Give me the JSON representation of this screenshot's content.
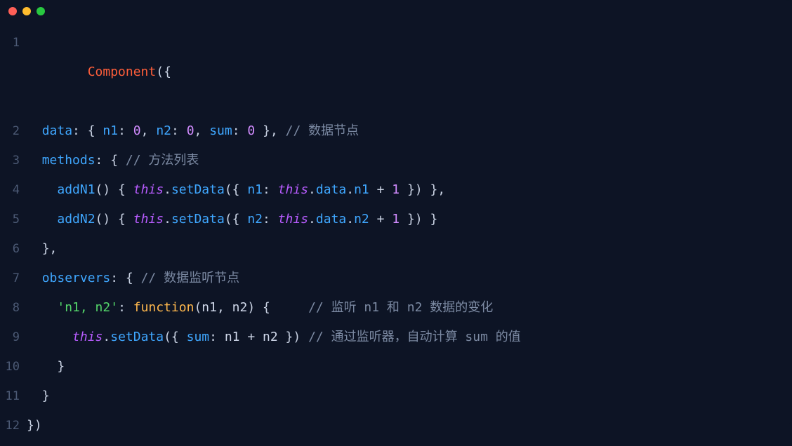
{
  "colors": {
    "close": "#ff5f57",
    "minimize": "#febc2e",
    "zoom": "#28c840"
  },
  "gutter": [
    "1",
    "2",
    "3",
    "4",
    "5",
    "6",
    "7",
    "8",
    "9",
    "10",
    "11",
    "12"
  ],
  "code": {
    "l1": {
      "a": "Component",
      "b": "({"
    },
    "l2": {
      "indent": "  ",
      "a": "data",
      "b": ": { ",
      "c": "n1",
      "d": ": ",
      "e": "0",
      "f": ", ",
      "g": "n2",
      "h": ": ",
      "i": "0",
      "j": ", ",
      "k": "sum",
      "l": ": ",
      "m": "0",
      "n": " }, ",
      "o": "// 数据节点"
    },
    "l3": {
      "indent": "  ",
      "a": "methods",
      "b": ": { ",
      "c": "// 方法列表"
    },
    "l4": {
      "indent": "    ",
      "a": "addN1",
      "b": "() { ",
      "c": "this",
      "d": ".",
      "e": "setData",
      "f": "({ ",
      "g": "n1",
      "h": ": ",
      "i": "this",
      "j": ".",
      "k": "data",
      "l": ".",
      "m": "n1",
      "n": " + ",
      "o": "1",
      "p": " }) },"
    },
    "l5": {
      "indent": "    ",
      "a": "addN2",
      "b": "() { ",
      "c": "this",
      "d": ".",
      "e": "setData",
      "f": "({ ",
      "g": "n2",
      "h": ": ",
      "i": "this",
      "j": ".",
      "k": "data",
      "l": ".",
      "m": "n2",
      "n": " + ",
      "o": "1",
      "p": " }) }"
    },
    "l6": {
      "indent": "  ",
      "a": "},"
    },
    "l7": {
      "indent": "  ",
      "a": "observers",
      "b": ": { ",
      "c": "// 数据监听节点"
    },
    "l8": {
      "indent": "    ",
      "a": "'n1, n2'",
      "b": ": ",
      "c": "function",
      "d": "(",
      "e": "n1",
      "f": ", ",
      "g": "n2",
      "h": ") {     ",
      "i": "// 监听 n1 和 n2 数据的变化"
    },
    "l9": {
      "indent": "      ",
      "a": "this",
      "b": ".",
      "c": "setData",
      "d": "({ ",
      "e": "sum",
      "f": ": ",
      "g": "n1",
      "h": " + ",
      "i": "n2",
      "j": " }) ",
      "k": "// 通过监听器，自动计算 sum 的值"
    },
    "l10": {
      "indent": "    ",
      "a": "}"
    },
    "l11": {
      "indent": "  ",
      "a": "}"
    },
    "l12": {
      "a": "})"
    }
  }
}
